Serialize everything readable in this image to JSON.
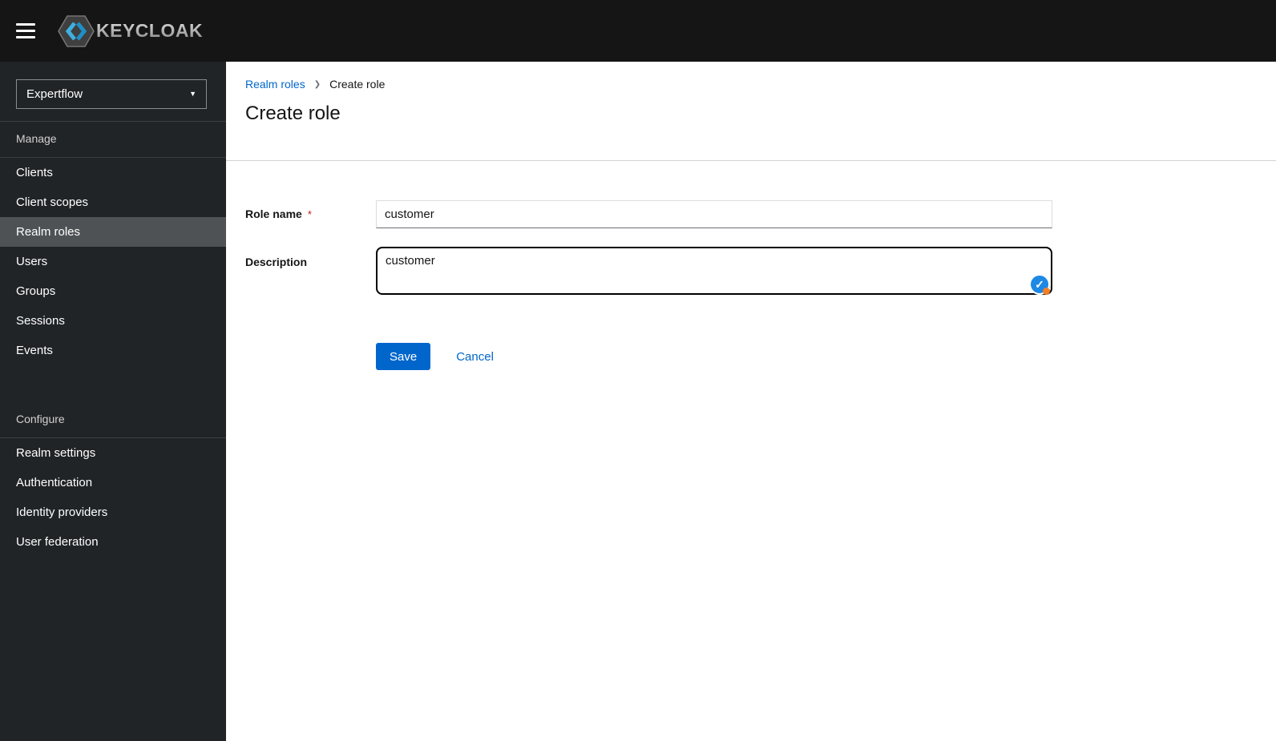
{
  "header": {
    "logo_text": "KEYCLOAK"
  },
  "sidebar": {
    "realm_selector": {
      "value": "Expertflow",
      "caret": "▼"
    },
    "sections": [
      {
        "title": "Manage",
        "items": [
          {
            "label": "Clients",
            "current": false
          },
          {
            "label": "Client scopes",
            "current": false
          },
          {
            "label": "Realm roles",
            "current": true
          },
          {
            "label": "Users",
            "current": false
          },
          {
            "label": "Groups",
            "current": false
          },
          {
            "label": "Sessions",
            "current": false
          },
          {
            "label": "Events",
            "current": false
          }
        ]
      },
      {
        "title": "Configure",
        "items": [
          {
            "label": "Realm settings",
            "current": false
          },
          {
            "label": "Authentication",
            "current": false
          },
          {
            "label": "Identity providers",
            "current": false
          },
          {
            "label": "User federation",
            "current": false
          }
        ]
      }
    ]
  },
  "breadcrumb": {
    "parent": "Realm roles",
    "separator": "❯",
    "current": "Create role"
  },
  "page": {
    "title": "Create role"
  },
  "form": {
    "role_name": {
      "label": "Role name",
      "required_marker": "*",
      "value": "customer"
    },
    "description": {
      "label": "Description",
      "value": "customer"
    },
    "actions": {
      "save": "Save",
      "cancel": "Cancel"
    }
  },
  "icons": {
    "grammarly_check": "✓"
  },
  "colors": {
    "topbar": "#151515",
    "sidebar_bg": "#212427",
    "nav_current_bg": "#4f5255",
    "accent_blue": "#0066cc",
    "required_red": "#c9190b",
    "grammarly_blue": "#1e88e5",
    "grammarly_dot_orange": "#f47f25",
    "header_divider": "#d2d2d2"
  }
}
